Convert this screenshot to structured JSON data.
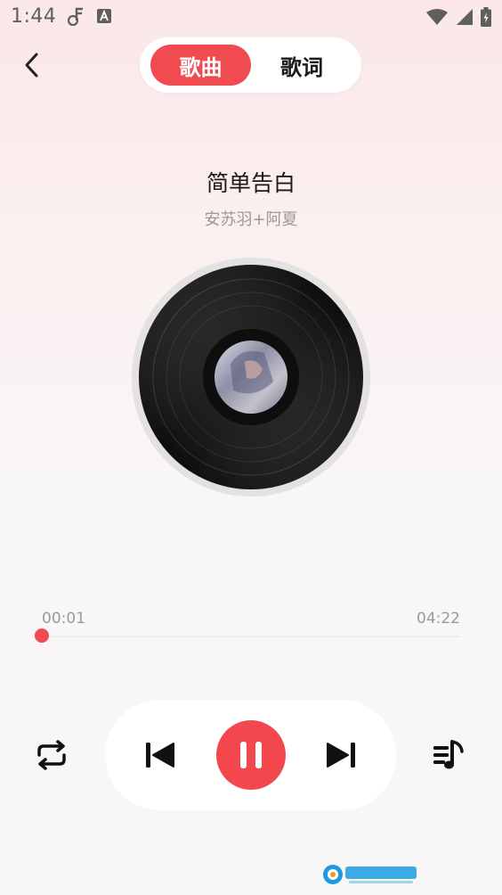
{
  "status_bar": {
    "time": "1:44",
    "icons": [
      "music-note-icon",
      "keyboard-a-icon",
      "wifi-icon",
      "signal-icon",
      "battery-icon"
    ]
  },
  "header": {
    "tabs": [
      {
        "label": "歌曲",
        "active": true
      },
      {
        "label": "歌词",
        "active": false
      }
    ]
  },
  "song": {
    "title": "简单告白",
    "artist": "安苏羽+阿夏"
  },
  "progress": {
    "current": "00:01",
    "total": "04:22",
    "fraction": 0.004
  },
  "controls": {
    "icons": [
      "repeat-icon",
      "previous-icon",
      "pause-icon",
      "next-icon",
      "playlist-icon"
    ]
  },
  "colors": {
    "accent": "#ef4b51",
    "text": "#1a1a1a",
    "muted": "#9a9a9a"
  }
}
